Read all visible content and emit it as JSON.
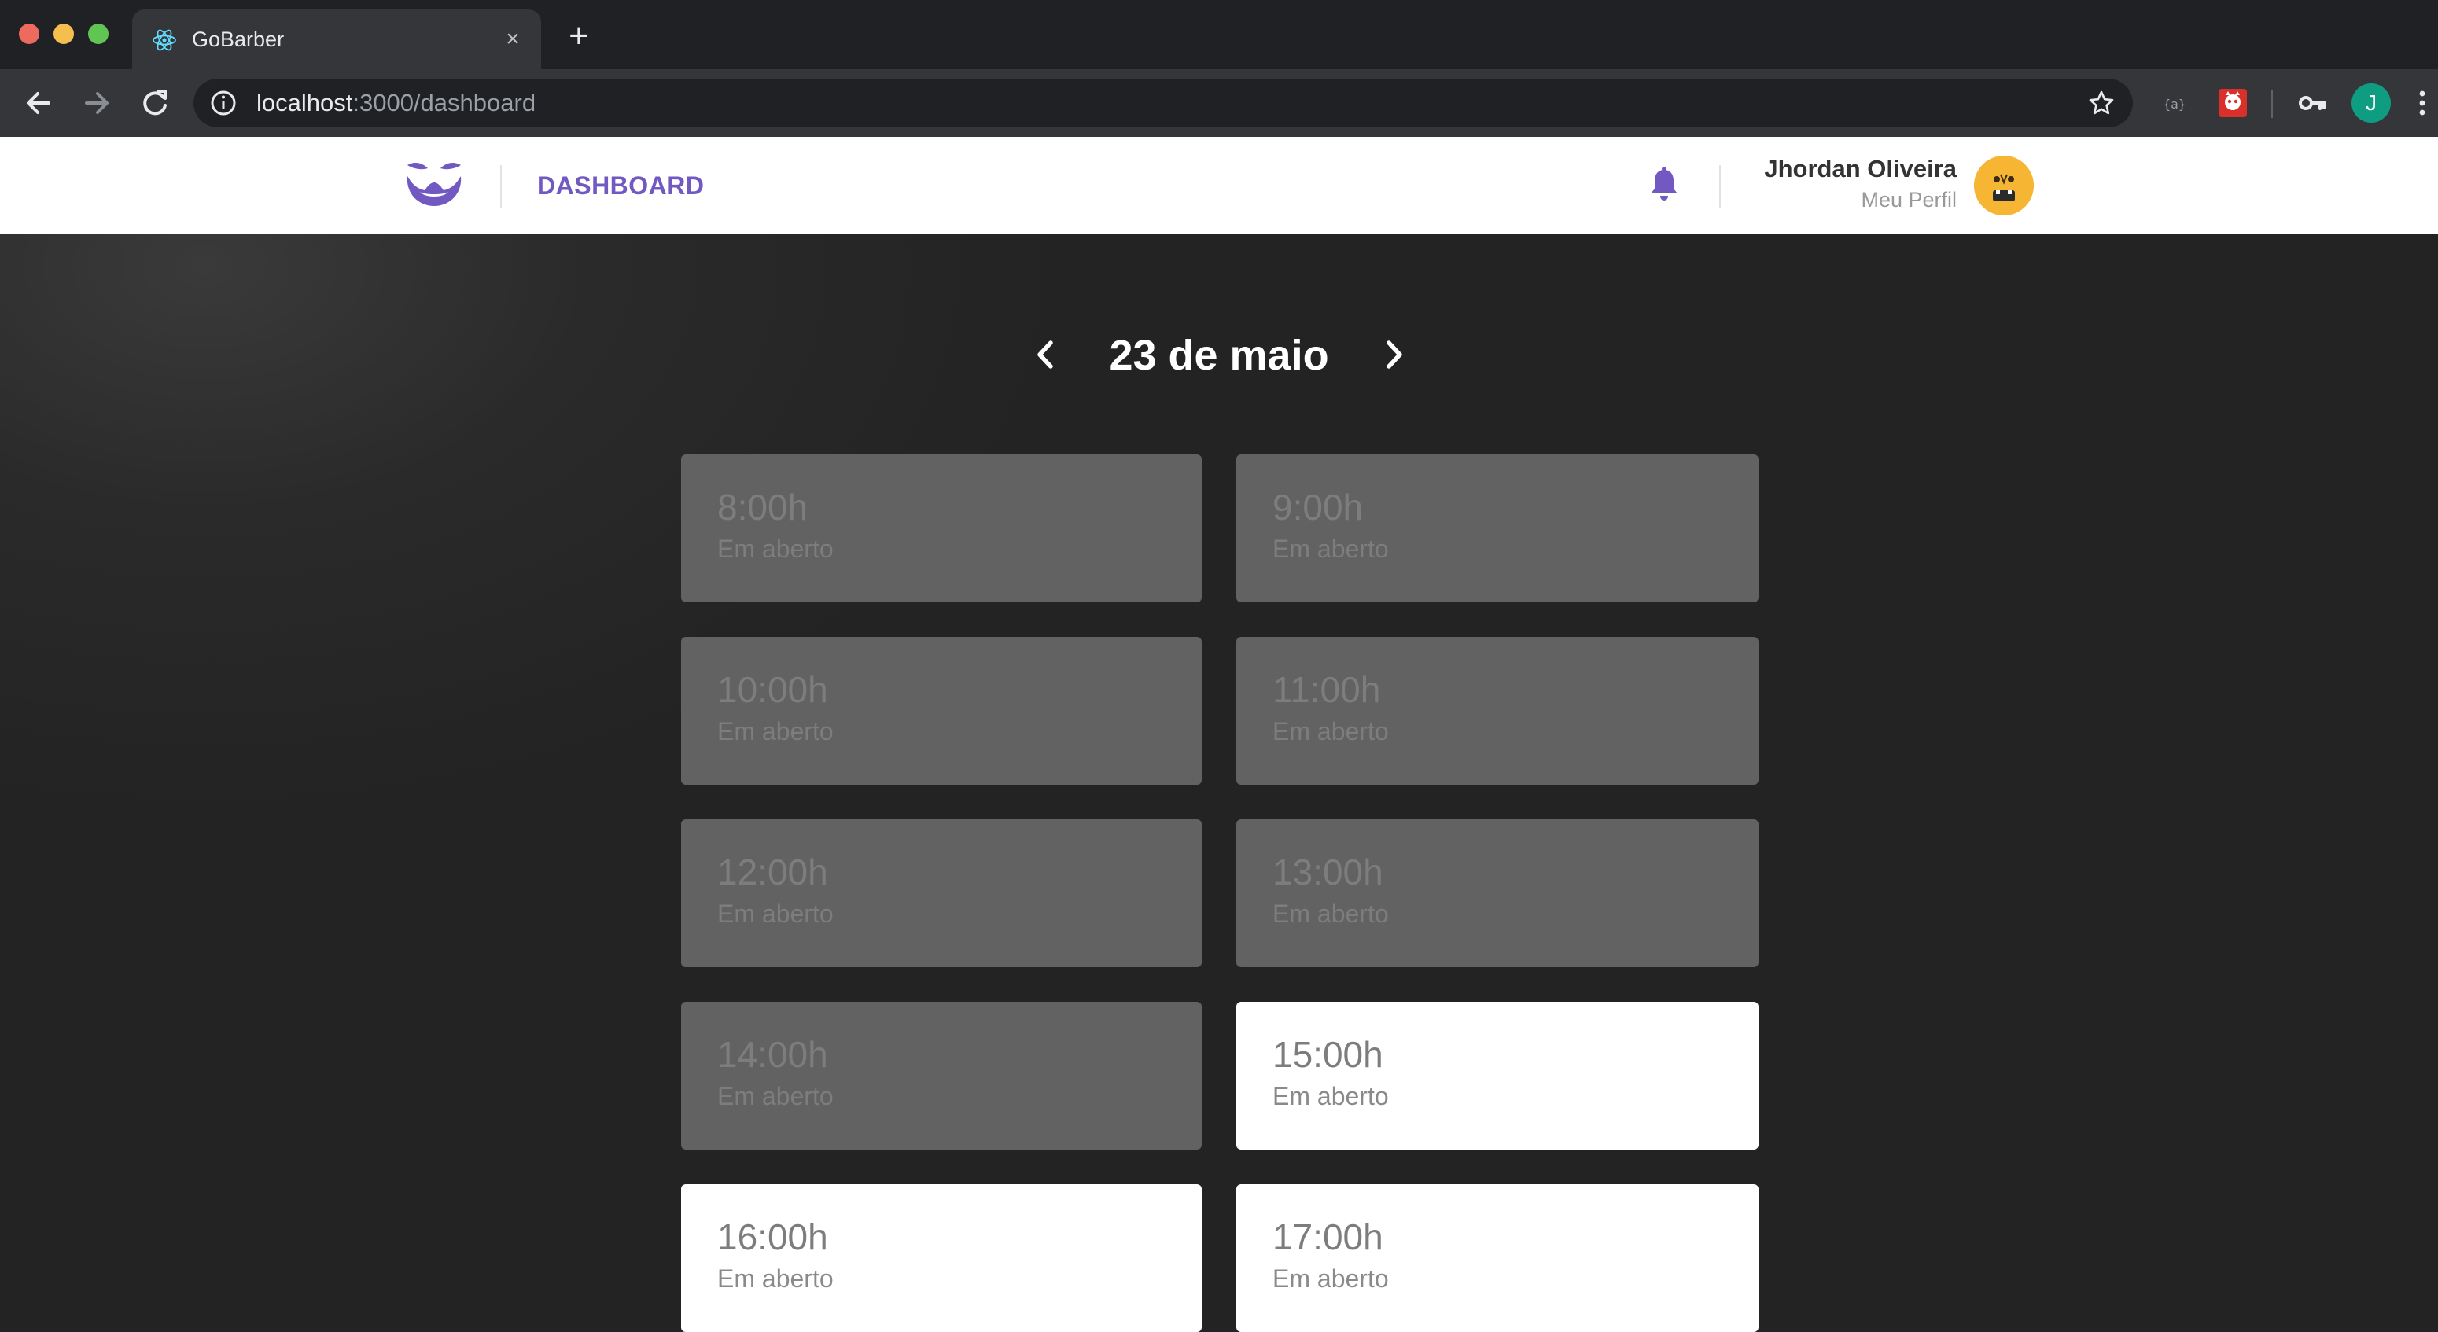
{
  "browser": {
    "tab_title": "GoBarber",
    "tab_favicon": "react-icon",
    "url_host": "localhost",
    "url_path": ":3000/dashboard",
    "profile_initial": "J",
    "extensions": [
      "json-viewer-icon",
      "octocat-extension-icon",
      "key-icon"
    ]
  },
  "header": {
    "logo": "gobarber-mustache-logo",
    "nav_label": "DASHBOARD",
    "notifications_icon": "bell-icon",
    "user_name": "Jhordan Oliveira",
    "profile_link": "Meu Perfil"
  },
  "schedule": {
    "date_label": "23 de maio",
    "prev_icon": "chevron-left-icon",
    "next_icon": "chevron-right-icon",
    "slots": [
      {
        "time": "8:00h",
        "status": "Em aberto",
        "past": true
      },
      {
        "time": "9:00h",
        "status": "Em aberto",
        "past": true
      },
      {
        "time": "10:00h",
        "status": "Em aberto",
        "past": true
      },
      {
        "time": "11:00h",
        "status": "Em aberto",
        "past": true
      },
      {
        "time": "12:00h",
        "status": "Em aberto",
        "past": true
      },
      {
        "time": "13:00h",
        "status": "Em aberto",
        "past": true
      },
      {
        "time": "14:00h",
        "status": "Em aberto",
        "past": true
      },
      {
        "time": "15:00h",
        "status": "Em aberto",
        "past": false
      },
      {
        "time": "16:00h",
        "status": "Em aberto",
        "past": false
      },
      {
        "time": "17:00h",
        "status": "Em aberto",
        "past": false
      }
    ]
  },
  "colors": {
    "brand": "#7159c1",
    "background": "#232323",
    "past_slot": "#626262",
    "open_slot": "#ffffff",
    "avatar": "#f6b532"
  }
}
